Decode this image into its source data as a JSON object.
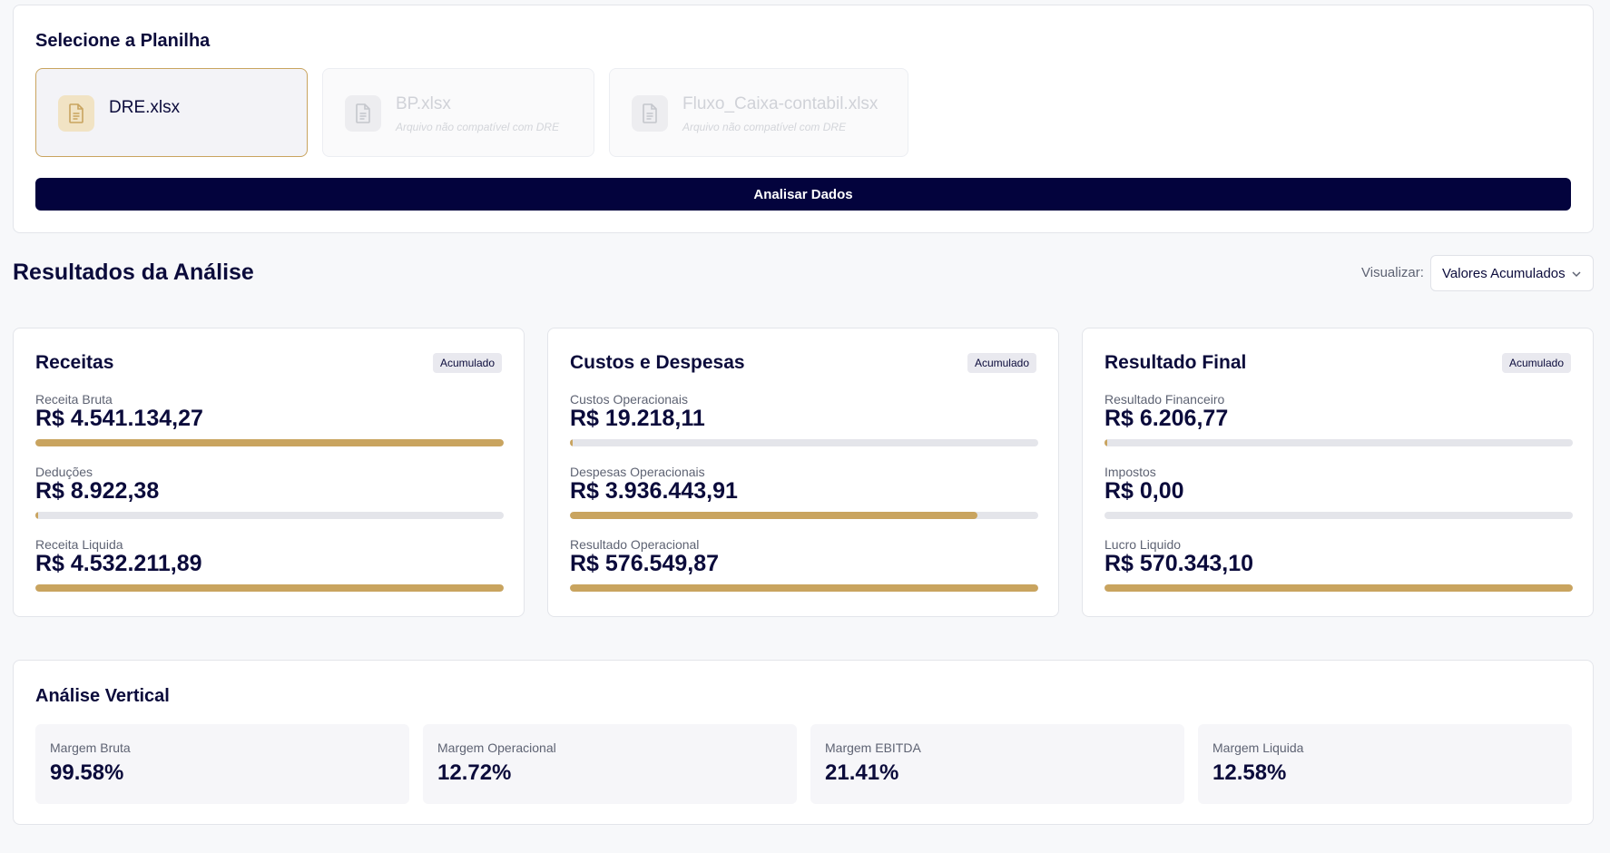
{
  "file_selector": {
    "title": "Selecione a Planilha",
    "files": [
      {
        "name": "DRE.xlsx",
        "note": "",
        "selected": true
      },
      {
        "name": "BP.xlsx",
        "note": "Arquivo não compatível com DRE",
        "selected": false
      },
      {
        "name": "Fluxo_Caixa-contabil.xlsx",
        "note": "Arquivo não compatível com DRE",
        "selected": false
      }
    ],
    "analyze_button": "Analisar Dados"
  },
  "results": {
    "title": "Resultados da Análise",
    "view_label": "Visualizar:",
    "view_selected": "Valores Acumulados"
  },
  "cards": [
    {
      "title": "Receitas",
      "badge": "Acumulado",
      "items": [
        {
          "label": "Receita Bruta",
          "value": "R$ 4.541.134,27",
          "fill_pct": 100
        },
        {
          "label": "Deduções",
          "value": "R$ 8.922,38",
          "fill_pct": 0.4
        },
        {
          "label": "Receita Liquida",
          "value": "R$ 4.532.211,89",
          "fill_pct": 100
        }
      ]
    },
    {
      "title": "Custos e Despesas",
      "badge": "Acumulado",
      "items": [
        {
          "label": "Custos Operacionais",
          "value": "R$ 19.218,11",
          "fill_pct": 0.4
        },
        {
          "label": "Despesas Operacionais",
          "value": "R$ 3.936.443,91",
          "fill_pct": 87
        },
        {
          "label": "Resultado Operacional",
          "value": "R$ 576.549,87",
          "fill_pct": 100
        }
      ]
    },
    {
      "title": "Resultado Final",
      "badge": "Acumulado",
      "items": [
        {
          "label": "Resultado Financeiro",
          "value": "R$ 6.206,77",
          "fill_pct": 0.4
        },
        {
          "label": "Impostos",
          "value": "R$ 0,00",
          "fill_pct": 0
        },
        {
          "label": "Lucro Liquido",
          "value": "R$ 570.343,10",
          "fill_pct": 100
        }
      ]
    }
  ],
  "vertical_analysis": {
    "title": "Análise Vertical",
    "items": [
      {
        "label": "Margem Bruta",
        "value": "99.58%"
      },
      {
        "label": "Margem Operacional",
        "value": "12.72%"
      },
      {
        "label": "Margem EBITDA",
        "value": "21.41%"
      },
      {
        "label": "Margem Liquida",
        "value": "12.58%"
      }
    ]
  },
  "colors": {
    "accent": "#c9a45f",
    "primary": "#03033d",
    "track": "#e4e5ea"
  },
  "icons": {
    "file": "file-spreadsheet-icon",
    "dropdown": "chevron-down-icon"
  }
}
